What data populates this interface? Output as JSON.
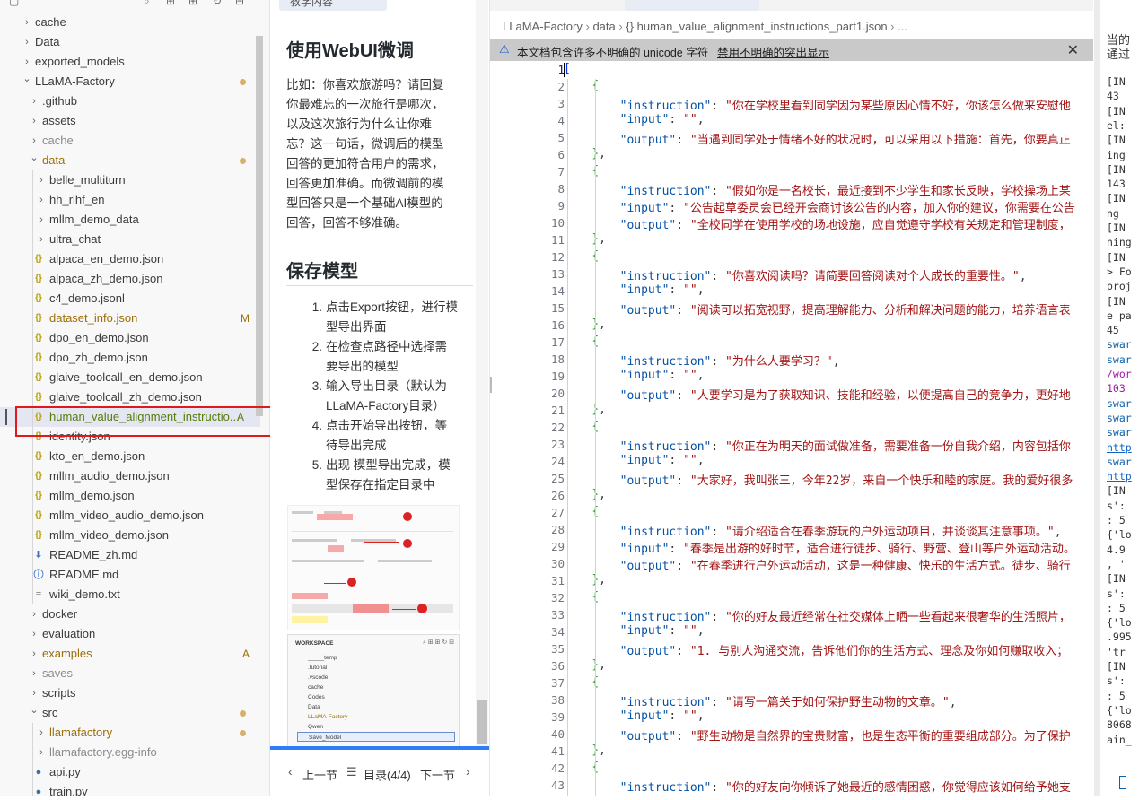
{
  "explorer": {
    "items": [
      {
        "label": "cache",
        "type": "folder",
        "open": false,
        "depth": 1,
        "gray": false
      },
      {
        "label": "Data",
        "type": "folder",
        "open": false,
        "depth": 1
      },
      {
        "label": "exported_models",
        "type": "folder",
        "open": false,
        "depth": 1
      },
      {
        "label": "LLaMA-Factory",
        "type": "folder",
        "open": true,
        "depth": 1,
        "dot": true
      },
      {
        "label": ".github",
        "type": "folder",
        "open": false,
        "depth": 2
      },
      {
        "label": "assets",
        "type": "folder",
        "open": false,
        "depth": 2
      },
      {
        "label": "cache",
        "type": "folder",
        "open": false,
        "depth": 2,
        "gray": true
      },
      {
        "label": "data",
        "type": "folder",
        "open": true,
        "depth": 2,
        "dot": true,
        "mod": true
      },
      {
        "label": "belle_multiturn",
        "type": "folder",
        "open": false,
        "depth": 3
      },
      {
        "label": "hh_rlhf_en",
        "type": "folder",
        "open": false,
        "depth": 3
      },
      {
        "label": "mllm_demo_data",
        "type": "folder",
        "open": false,
        "depth": 3
      },
      {
        "label": "ultra_chat",
        "type": "folder",
        "open": false,
        "depth": 3
      },
      {
        "label": "alpaca_en_demo.json",
        "type": "json",
        "depth": 3
      },
      {
        "label": "alpaca_zh_demo.json",
        "type": "json",
        "depth": 3
      },
      {
        "label": "c4_demo.jsonl",
        "type": "json",
        "depth": 3
      },
      {
        "label": "dataset_info.json",
        "type": "json",
        "depth": 3,
        "badge": "M",
        "mod": true
      },
      {
        "label": "dpo_en_demo.json",
        "type": "json",
        "depth": 3
      },
      {
        "label": "dpo_zh_demo.json",
        "type": "json",
        "depth": 3
      },
      {
        "label": "glaive_toolcall_en_demo.json",
        "type": "json",
        "depth": 3
      },
      {
        "label": "glaive_toolcall_zh_demo.json",
        "type": "json",
        "depth": 3
      },
      {
        "label": "human_value_alignment_instructio...",
        "type": "json",
        "depth": 3,
        "badge": "A",
        "add": true,
        "selected": true
      },
      {
        "label": "identity.json",
        "type": "json",
        "depth": 3
      },
      {
        "label": "kto_en_demo.json",
        "type": "json",
        "depth": 3
      },
      {
        "label": "mllm_audio_demo.json",
        "type": "json",
        "depth": 3
      },
      {
        "label": "mllm_demo.json",
        "type": "json",
        "depth": 3
      },
      {
        "label": "mllm_video_audio_demo.json",
        "type": "json",
        "depth": 3
      },
      {
        "label": "mllm_video_demo.json",
        "type": "json",
        "depth": 3
      },
      {
        "label": "README_zh.md",
        "type": "md-down",
        "depth": 3
      },
      {
        "label": "README.md",
        "type": "md-info",
        "depth": 3
      },
      {
        "label": "wiki_demo.txt",
        "type": "txt",
        "depth": 3
      },
      {
        "label": "docker",
        "type": "folder",
        "open": false,
        "depth": 2
      },
      {
        "label": "evaluation",
        "type": "folder",
        "open": false,
        "depth": 2
      },
      {
        "label": "examples",
        "type": "folder",
        "open": false,
        "depth": 2,
        "badge": "A",
        "mod": true
      },
      {
        "label": "saves",
        "type": "folder",
        "open": false,
        "depth": 2,
        "gray": true
      },
      {
        "label": "scripts",
        "type": "folder",
        "open": false,
        "depth": 2
      },
      {
        "label": "src",
        "type": "folder",
        "open": true,
        "depth": 2,
        "dot": true
      },
      {
        "label": "llamafactory",
        "type": "folder",
        "open": false,
        "depth": 3,
        "dot": true,
        "mod": true
      },
      {
        "label": "llamafactory.egg-info",
        "type": "folder",
        "open": false,
        "depth": 3,
        "gray": true
      },
      {
        "label": "api.py",
        "type": "py",
        "depth": 3
      },
      {
        "label": "train.py",
        "type": "py",
        "depth": 3
      }
    ]
  },
  "tutorial": {
    "tab_label": "教学内容",
    "heading1": "使用WebUI微调",
    "para": [
      {
        "text": "比如：",
        "code": false
      },
      {
        "text": "你喜欢旅游吗？请回复你最难忘的一次旅行是哪次，以及这次旅行为什么让你难忘？",
        "code": true
      },
      {
        "text": "这一句话，微调后的模型回答的更加符合用户的需求，回答更加准确。而微调前的模型回答只是一个基础AI模型的回答，回答不够准确。",
        "code": false
      }
    ],
    "para_lines": [
      "比如：你喜欢旅游吗？请回复",
      "你最难忘的一次旅行是哪次，",
      "以及这次旅行为什么让你难",
      "忘？这一句话，微调后的模型",
      "回答的更加符合用户的需求，",
      "回答更加准确。而微调前的模",
      "型回答只是一个基础AI模型的",
      "回答，回答不够准确。"
    ],
    "heading2": "保存模型",
    "steps": [
      {
        "n": "1.",
        "lines": [
          "点击Export按钮，进行模",
          "型导出界面"
        ]
      },
      {
        "n": "2.",
        "lines": [
          "在检查点路径中选择需",
          "要导出的模型"
        ]
      },
      {
        "n": "3.",
        "lines": [
          "输入导出目录（默认为",
          "LLaMA-Factory目录）"
        ]
      },
      {
        "n": "4.",
        "lines": [
          "点击开始导出按钮，等",
          "待导出完成"
        ]
      },
      {
        "n": "5.",
        "lines": [
          "出现 模型导出完成，模",
          "型保存在指定目录中"
        ]
      }
    ],
    "thumb2": {
      "title": "WORKSPACE",
      "items": [
        "_____temp",
        ".tutorial",
        ".vscode",
        "cache",
        "Codes",
        "Data",
        "LLaMA-Factory",
        "Qwen",
        "Save_Model"
      ]
    },
    "footer": {
      "prev": "上一节",
      "toc": "目录(4/4)",
      "next": "下一节"
    }
  },
  "editor": {
    "breadcrumb": [
      "LLaMA-Factory",
      "data",
      "{} human_value_alignment_instructions_part1.json",
      "..."
    ],
    "warning": "本文档包含许多不明确的 unicode 字符",
    "warning_link": "禁用不明确的突出显示",
    "start_line": 1,
    "lines": [
      "[",
      "    {",
      "        \"instruction\": \"你在学校里看到同学因为某些原因心情不好，你该怎么做来安慰他",
      "        \"input\": \"\",",
      "        \"output\": \"当遇到同学处于情绪不好的状况时，可以采用以下措施：首先，你要真正",
      "    },",
      "    {",
      "        \"instruction\": \"假如你是一名校长，最近接到不少学生和家长反映，学校操场上某",
      "        \"input\": \"公告起草委员会已经开会商讨该公告的内容，加入你的建议，你需要在公告",
      "        \"output\": \"全校同学在使用学校的场地设施，应自觉遵守学校有关规定和管理制度，",
      "    },",
      "    {",
      "        \"instruction\": \"你喜欢阅读吗？请简要回答阅读对个人成长的重要性。\",",
      "        \"input\": \"\",",
      "        \"output\": \"阅读可以拓宽视野，提高理解能力、分析和解决问题的能力，培养语言表",
      "    },",
      "    {",
      "        \"instruction\": \"为什么人要学习？\",",
      "        \"input\": \"\",",
      "        \"output\": \"人要学习是为了获取知识、技能和经验，以便提高自己的竞争力，更好地",
      "    },",
      "    {",
      "        \"instruction\": \"你正在为明天的面试做准备，需要准备一份自我介绍，内容包括你",
      "        \"input\": \"\",",
      "        \"output\": \"大家好，我叫张三，今年22岁，来自一个快乐和睦的家庭。我的爱好很多",
      "    },",
      "    {",
      "        \"instruction\": \"请介绍适合在春季游玩的户外运动项目，并谈谈其注意事项。\",",
      "        \"input\": \"春季是出游的好时节，适合进行徒步、骑行、野营、登山等户外运动活动。",
      "        \"output\": \"在春季进行户外运动活动，这是一种健康、快乐的生活方式。徒步、骑行",
      "    },",
      "    {",
      "        \"instruction\": \"你的好友最近经常在社交媒体上晒一些看起来很奢华的生活照片，",
      "        \"input\": \"\",",
      "        \"output\": \"1. 与别人沟通交流，告诉他们你的生活方式、理念及你如何赚取收入；",
      "    },",
      "    {",
      "        \"instruction\": \"请写一篇关于如何保护野生动物的文章。\",",
      "        \"input\": \"\",",
      "        \"output\": \"野生动物是自然界的宝贵财富，也是生态平衡的重要组成部分。为了保护",
      "    },",
      "    {",
      "        \"instruction\": \"你的好友向你倾诉了她最近的感情困惑，你觉得应该如何给予她支"
    ]
  },
  "terminal": {
    "header1": "当的",
    "header2": "通过",
    "lines": [
      {
        "t": "[IN",
        "c": ""
      },
      {
        "t": "43 ",
        "c": ""
      },
      {
        "t": "[IN",
        "c": ""
      },
      {
        "t": "el:",
        "c": ""
      },
      {
        "t": "[IN",
        "c": ""
      },
      {
        "t": "ing",
        "c": ""
      },
      {
        "t": "[IN",
        "c": ""
      },
      {
        "t": "143",
        "c": ""
      },
      {
        "t": "[IN",
        "c": ""
      },
      {
        "t": "ng ",
        "c": ""
      },
      {
        "t": "[IN",
        "c": ""
      },
      {
        "t": "ning",
        "c": ""
      },
      {
        "t": "[IN",
        "c": ""
      },
      {
        "t": "> Fo",
        "c": ""
      },
      {
        "t": "proj",
        "c": ""
      },
      {
        "t": "[IN",
        "c": ""
      },
      {
        "t": "e pa",
        "c": ""
      },
      {
        "t": "45 ",
        "c": ""
      },
      {
        "t": "swar",
        "c": "blue"
      },
      {
        "t": "swar",
        "c": "blue"
      },
      {
        "t": "/wor",
        "c": "purple"
      },
      {
        "t": "103",
        "c": "purple"
      },
      {
        "t": "swar",
        "c": "blue"
      },
      {
        "t": "swar",
        "c": "blue"
      },
      {
        "t": "swar",
        "c": "blue"
      },
      {
        "t": "http",
        "c": "link"
      },
      {
        "t": "swar",
        "c": "blue"
      },
      {
        "t": "http",
        "c": "link"
      },
      {
        "t": "[IN",
        "c": ""
      },
      {
        "t": "s':",
        "c": ""
      },
      {
        "t": ": 5",
        "c": ""
      },
      {
        "t": "{'lo",
        "c": ""
      },
      {
        "t": "4.9",
        "c": ""
      },
      {
        "t": ", '",
        "c": ""
      },
      {
        "t": "[IN",
        "c": ""
      },
      {
        "t": "s':",
        "c": ""
      },
      {
        "t": ": 5",
        "c": ""
      },
      {
        "t": "{'lo",
        "c": ""
      },
      {
        "t": ".995",
        "c": ""
      },
      {
        "t": " 'tr",
        "c": ""
      },
      {
        "t": "[IN",
        "c": ""
      },
      {
        "t": "s':",
        "c": ""
      },
      {
        "t": ": 5",
        "c": ""
      },
      {
        "t": "{'lo",
        "c": ""
      },
      {
        "t": "8068",
        "c": ""
      },
      {
        "t": "ain_",
        "c": ""
      }
    ]
  },
  "colors": {
    "accent": "#2e7cf6",
    "highlight_box": "#e01a1a",
    "modified": "#9d6e07",
    "added": "#587c0c"
  }
}
